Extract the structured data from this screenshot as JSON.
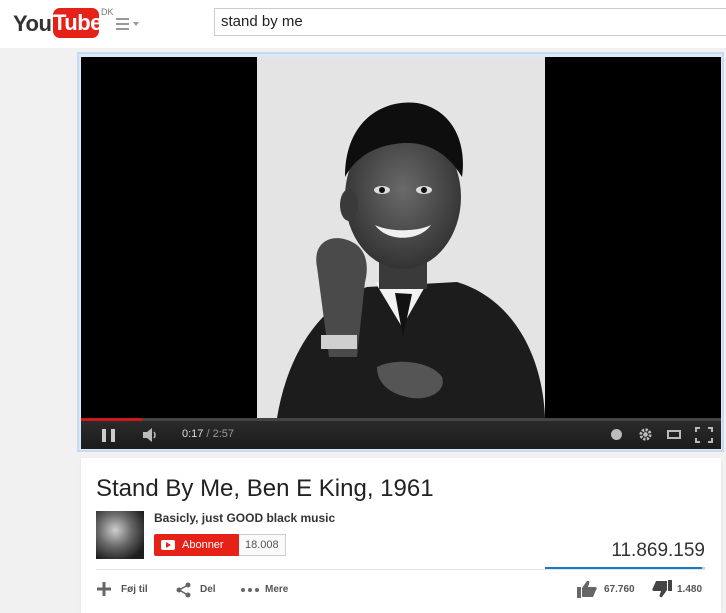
{
  "header": {
    "logo_you": "You",
    "logo_tube": "Tube",
    "country": "DK",
    "search_value": "stand by me"
  },
  "player": {
    "current_time": "0:17",
    "separator": " / ",
    "duration": "2:57",
    "progress_fraction": 0.096
  },
  "video": {
    "title": "Stand By Me, Ben E King, 1961",
    "channel_name": "Basicly, just GOOD black music",
    "subscribe_label": "Abonner",
    "subscriber_count": "18.008",
    "view_count": "11.869.159",
    "add_to_label": "Føj til",
    "share_label": "Del",
    "more_label": "Mere",
    "likes": "67.760",
    "dislikes": "1.480"
  },
  "colors": {
    "brand_red": "#e62117",
    "progress_red": "#cc181e",
    "sentiment_blue": "#167ac6"
  }
}
